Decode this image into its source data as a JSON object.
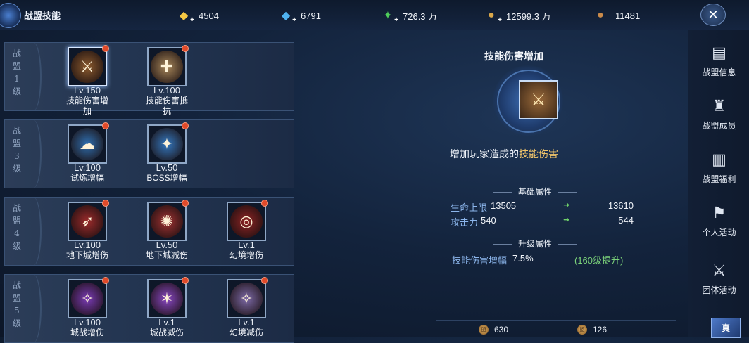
{
  "header": {
    "title": "战盟技能",
    "resources": [
      {
        "icon": "gold-diamond-icon",
        "value": "4504",
        "color": "#f5c743"
      },
      {
        "icon": "blue-diamond-icon",
        "value": "6791",
        "color": "#4fb2f0"
      },
      {
        "icon": "green-crystal-icon",
        "value": "726.3 万",
        "color": "#4ecb5a"
      },
      {
        "icon": "gold-coin-icon",
        "value": "12599.3 万",
        "color": "#d9a74a"
      },
      {
        "icon": "guild-coin-icon",
        "value": "11481",
        "color": "#c98a4a"
      }
    ],
    "close_label": "✕"
  },
  "tiers": [
    {
      "label": "战盟1级",
      "chars": [
        "战",
        "盟",
        "1",
        "级"
      ],
      "skills": [
        {
          "level": "Lv.150",
          "name": "技能伤害增加",
          "selected": true,
          "color": "#8b5a2e",
          "glyph": "⚔"
        },
        {
          "level": "Lv.100",
          "name": "技能伤害抵抗",
          "selected": false,
          "color": "#a8875a",
          "glyph": "✚"
        }
      ]
    },
    {
      "label": "战盟3级",
      "chars": [
        "战",
        "盟",
        "3",
        "级"
      ],
      "skills": [
        {
          "level": "Lv.100",
          "name": "试炼增幅",
          "selected": false,
          "color": "#2f6fb0",
          "glyph": "☁"
        },
        {
          "level": "Lv.50",
          "name": "BOSS增幅",
          "selected": false,
          "color": "#3478c0",
          "glyph": "✦"
        }
      ]
    },
    {
      "label": "战盟4级",
      "chars": [
        "战",
        "盟",
        "4",
        "级"
      ],
      "skills": [
        {
          "level": "Lv.100",
          "name": "地下城增伤",
          "selected": false,
          "color": "#9c2b2b",
          "glyph": "➶"
        },
        {
          "level": "Lv.50",
          "name": "地下城减伤",
          "selected": false,
          "color": "#a03232",
          "glyph": "✺"
        },
        {
          "level": "Lv.1",
          "name": "幻境增伤",
          "selected": false,
          "color": "#8e2424",
          "glyph": "◎"
        }
      ]
    },
    {
      "label": "战盟5级",
      "chars": [
        "战",
        "盟",
        "5",
        "级"
      ],
      "skills": [
        {
          "level": "Lv.100",
          "name": "城战增伤",
          "selected": false,
          "color": "#7a3bb5",
          "glyph": "✧"
        },
        {
          "level": "Lv.1",
          "name": "城战减伤",
          "selected": false,
          "color": "#8a48c5",
          "glyph": "✶"
        },
        {
          "level": "Lv.1",
          "name": "幻境减伤",
          "selected": false,
          "color": "#7d6aa8",
          "glyph": "✧"
        }
      ]
    }
  ],
  "detail": {
    "title": "技能伤害增加",
    "desc_prefix": "增加玩家造成的",
    "desc_highlight": "技能伤害",
    "base_section": "基础属性",
    "upgrade_section": "升级属性",
    "stats": [
      {
        "key": "生命上限",
        "current": "13505",
        "next": "13610"
      },
      {
        "key": "攻击力",
        "current": "540",
        "next": "544"
      }
    ],
    "upgrade": {
      "key": "技能伤害增幅",
      "value": "7.5%",
      "note": "(160级提升)"
    },
    "costs": [
      "630",
      "126"
    ]
  },
  "nav": [
    {
      "label": "战盟信息",
      "icon": "scroll-icon"
    },
    {
      "label": "战盟成员",
      "icon": "helmet-icon"
    },
    {
      "label": "战盟福利",
      "icon": "gift-icon"
    },
    {
      "label": "个人活动",
      "icon": "banner-icon"
    },
    {
      "label": "团体活动",
      "icon": "crossed-swords-icon"
    }
  ],
  "nav_corner": "真"
}
